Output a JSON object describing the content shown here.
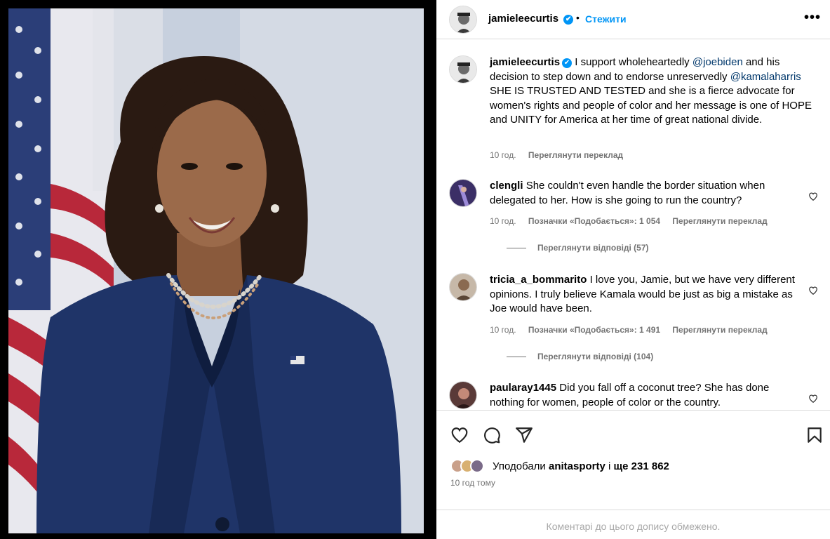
{
  "post_author": {
    "username": "jamieleecurtis",
    "verified_label": "✔",
    "separator": "•",
    "follow_label": "Стежити",
    "more_label": "•••"
  },
  "caption": {
    "username": "jamieleecurtis",
    "text_part1": "I support wholeheartedly ",
    "mention1": "@joebiden",
    "text_part2": " and his decision to step down and to endorse unreservedly ",
    "mention2": "@kamalaharris",
    "text_part3": "SHE IS TRUSTED AND TESTED and she is a fierce advocate for women's rights and people of color and her message is one of HOPE and UNITY for America at her time of great national divide.",
    "time": "10 год.",
    "translate": "Переглянути переклад"
  },
  "comments": [
    {
      "username": "clengli",
      "text": "She couldn't even handle the border situation when delegated to her. How is she going to run the country?",
      "time": "10 год.",
      "likes": "Позначки «Подобається»: 1 054",
      "translate": "Переглянути переклад",
      "replies": "Переглянути відповіді (57)"
    },
    {
      "username": "tricia_a_bommarito",
      "text": "I love you, Jamie, but we have very different opinions. I truly believe Kamala would be just as big a mistake as Joe would have been.",
      "time": "10 год.",
      "likes": "Позначки «Подобається»: 1 491",
      "translate": "Переглянути переклад",
      "replies": "Переглянути відповіді (104)"
    },
    {
      "username": "paularay1445",
      "text": "Did you fall off a coconut tree? She has done nothing for women, people of color or the country."
    }
  ],
  "likes_bar": {
    "prefix": "Уподобали ",
    "user": "anitasporty",
    "middle": " і ",
    "count": "ще 231 862"
  },
  "post_time": "10 год тому",
  "footer_notice": "Коментарі до цього допису обмежено.",
  "icons": [
    "heart-icon",
    "comment-icon",
    "share-icon",
    "bookmark-icon"
  ],
  "colors": {
    "link_blue": "#0095f6",
    "mention": "#00376b",
    "secondary": "#737373"
  }
}
